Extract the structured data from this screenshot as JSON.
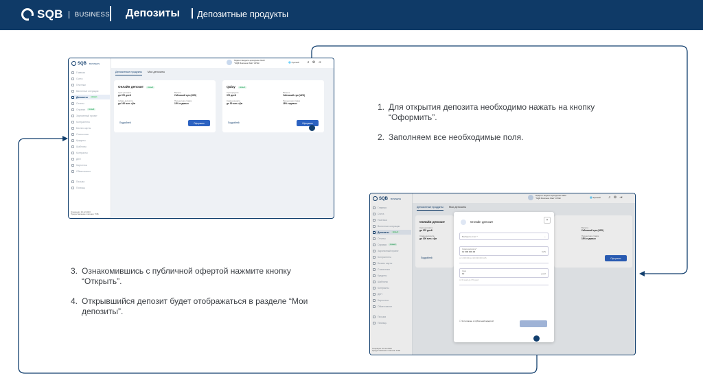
{
  "header": {
    "brand": "SQB",
    "brand_sub": "BUSINESS",
    "title": "Депозиты",
    "subtitle": "Депозитные продукты"
  },
  "app": {
    "brand": "SQB",
    "brand_sub": "BUSINESS",
    "account_line1": "Пидишт видели ерхоррово 6422",
    "account_line2": "\"SQB Business Web\" КРЭК",
    "language": "Русский",
    "sidebar": [
      {
        "label": "Главная",
        "active": false
      },
      {
        "label": "Счета",
        "active": false
      },
      {
        "label": "Платежи",
        "active": false
      },
      {
        "label": "Валютные операции",
        "active": false
      },
      {
        "label": "Депозиты",
        "active": true,
        "badge": "Новый"
      },
      {
        "label": "Отчеты",
        "active": false
      },
      {
        "label": "Справки",
        "active": false,
        "badge": "Новый"
      },
      {
        "label": "Зарплатный проект",
        "active": false
      },
      {
        "label": "Контрагенты",
        "active": false
      },
      {
        "label": "Бизнес карты",
        "active": false
      },
      {
        "label": "Статистика",
        "active": false
      },
      {
        "label": "Кредиты",
        "active": false
      },
      {
        "label": "Шаблоны",
        "active": false
      },
      {
        "label": "Контракты",
        "active": false
      },
      {
        "label": "ДКП",
        "active": false
      },
      {
        "label": "Картотека",
        "active": false
      },
      {
        "label": "Обмен валют",
        "active": false
      },
      {
        "label": "Письма",
        "active": false
      },
      {
        "label": "Помощь",
        "active": false
      }
    ],
    "footer": [
      "Операции: 29.12.2023",
      "Предоставление платежа: ТОВ"
    ],
    "tabs": [
      "Депозитные продукты",
      "Мои депозиты"
    ],
    "cards": [
      {
        "title": "Онлайн депозит",
        "badge": "Новый",
        "term_label": "Срок депозита",
        "term_value": "до 370 дней",
        "currency_label": "Валюта",
        "currency_value": "Узбекский сум (UZS)",
        "amount_label": "Сумма депозита",
        "amount_value": "до 100 млн. сўм",
        "rate_label": "Процентная ставка",
        "rate_value": "15% годовых",
        "more": "Подробней",
        "button": "Оформить"
      },
      {
        "title": "Qulay",
        "badge": "Новый",
        "term_label": "Срок кредита",
        "term_value": "370 дней",
        "currency_label": "Валюта",
        "currency_value": "Узбекский сум (UZS)",
        "amount_label": "Сумма кредита",
        "amount_value": "до 50 млн. сўм",
        "rate_label": "Процентная ставка",
        "rate_value": "18% годовых",
        "more": "Подробней",
        "button": "Оформить"
      }
    ],
    "modal": {
      "title": "Онлайн депозит",
      "close": "×",
      "select_placeholder": "Выберите счет *",
      "amount_label": "Сумма депозита *",
      "amount_value": "12 000 000.00",
      "amount_currency": "UZS",
      "amount_hint": "от 1 000 000 до 100 000 000 UZS",
      "term_label": "Срок",
      "term_value": "12",
      "term_unit": "дней",
      "term_hint": "от 30 дней до 370 дней",
      "agree": "Я согласен с публичной офертой"
    }
  },
  "instructions": {
    "group1": [
      {
        "num": "1.",
        "text": "Для открытия депозита необходимо нажать на кнопку “Оформить”."
      },
      {
        "num": "2.",
        "text": "Заполняем все необходимые поля."
      }
    ],
    "group2": [
      {
        "num": "3.",
        "text": "Ознакомившись с публичной офертой нажмите кнопку “Открыть”."
      },
      {
        "num": "4.",
        "text": "Открывшийся депозит будет отображаться в разделе “Мои депозиты”."
      }
    ]
  },
  "colors": {
    "header": "#0f3a67",
    "line": "#123f6e",
    "accent": "#2c62c1"
  }
}
